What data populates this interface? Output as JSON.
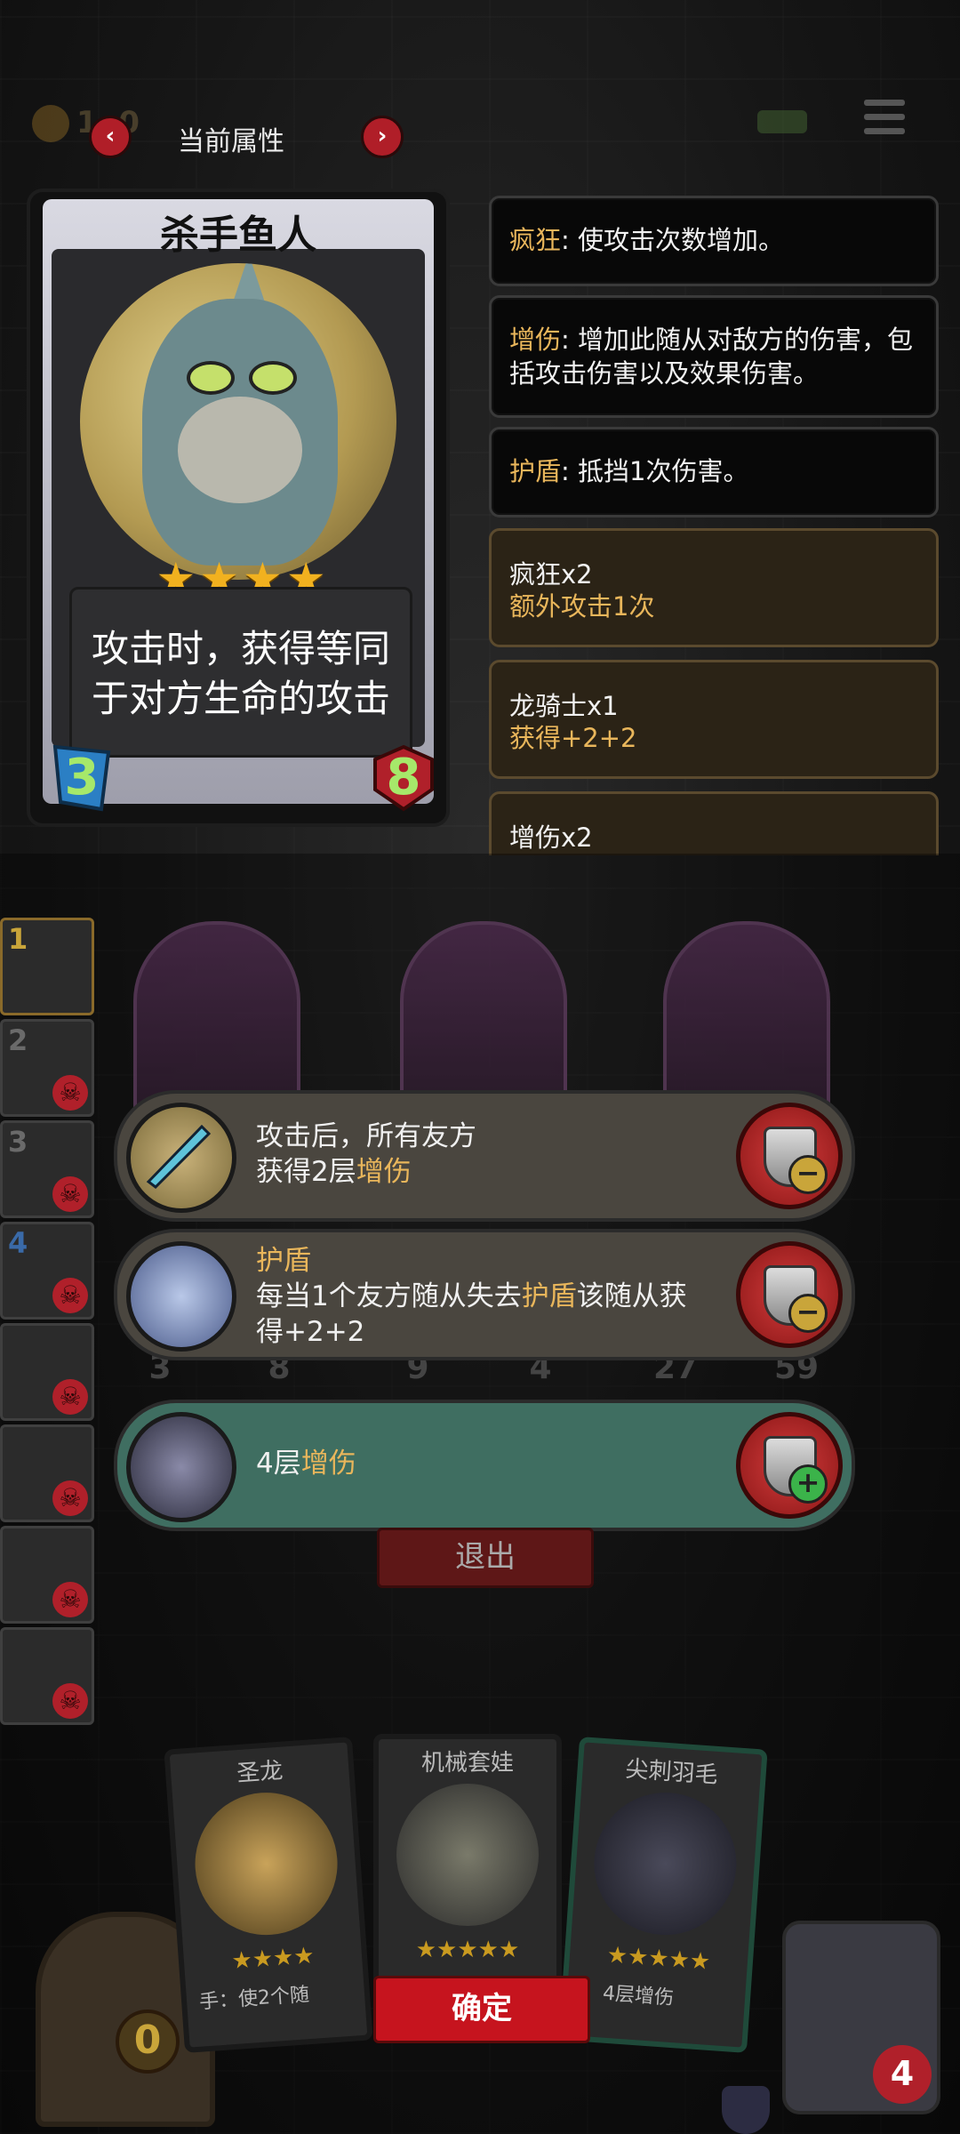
{
  "top_bar": {
    "coin_value": "1",
    "coin_value_tail": "0",
    "prev_label": "‹",
    "next_label": "›",
    "title": "当前属性"
  },
  "card": {
    "name": "杀手鱼人",
    "stars": "★★★★",
    "description": "攻击时，获得等同于对方生命的攻击",
    "attack": "3",
    "health": "8"
  },
  "info_panels": [
    {
      "keyword": "疯狂",
      "text": ": 使攻击次数增加。"
    },
    {
      "keyword": "增伤",
      "text": ": 增加此随从对敌方的伤害，包括攻击伤害以及效果伤害。"
    },
    {
      "keyword": "护盾",
      "text": ": 抵挡1次伤害。"
    }
  ],
  "stack_panels": [
    {
      "line1": "疯狂x2",
      "line2": "额外攻击1次"
    },
    {
      "line1": "龙骑士x1",
      "line2": "获得+2+2"
    },
    {
      "line1": "增伤x2",
      "line2": ""
    }
  ],
  "slots": [
    "1",
    "2",
    "3",
    "4",
    "",
    "",
    "",
    ""
  ],
  "minion_stats": {
    "m1_atk": "3",
    "m1_hp": "8",
    "m2_atk": "9",
    "m2_hp": "4",
    "m3_atk": "27",
    "m3_hp": "59"
  },
  "effects": [
    {
      "pre": "攻击后，所有友方",
      "line2_pre": "获得2层",
      "line2_kw": "增伤",
      "sign": "−"
    },
    {
      "title_kw": "护盾",
      "line2_pre": "每当1个友方随从失去",
      "line2_kw": "护盾",
      "line2_post": "该随从获",
      "line3": "得+2+2",
      "sign": "−"
    },
    {
      "pre": "4层",
      "kw": "增伤",
      "sign": "+"
    }
  ],
  "exit_label": "退出",
  "bottom_cards": [
    {
      "name": "圣龙",
      "stars": "★★★★",
      "desc": "手：使2个随"
    },
    {
      "name": "机械套娃",
      "stars": "★★★★★",
      "desc": ""
    },
    {
      "name": "尖刺羽毛",
      "stars": "★★★★★",
      "desc": "4层增伤"
    }
  ],
  "confirm_label": "确定",
  "door_count": "0",
  "hero_hp": "4",
  "colors": {
    "keyword": "#e9b65b",
    "danger": "#c6141e",
    "effect_green": "#3f6e61"
  }
}
